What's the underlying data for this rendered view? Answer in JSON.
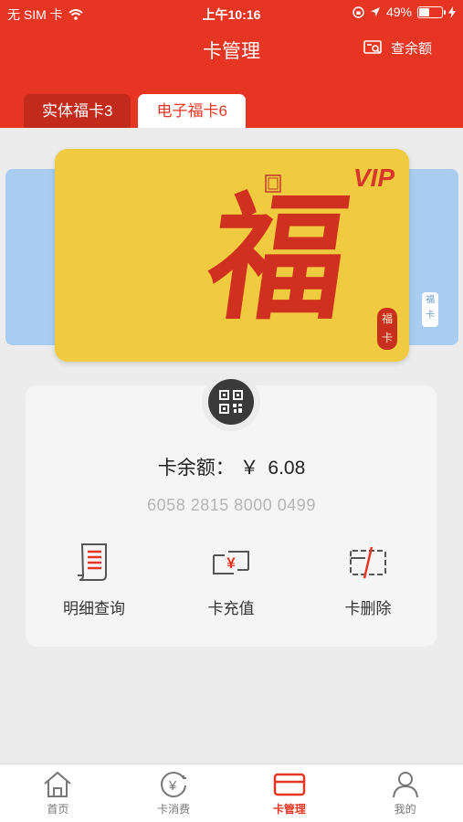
{
  "status_bar": {
    "carrier": "无 SIM 卡",
    "time": "上午10:16",
    "battery": "49%",
    "battery_level": 0.49
  },
  "header": {
    "title": "卡管理",
    "balance_button": "查余额"
  },
  "tabs": [
    {
      "label": "实体福卡3",
      "active": false
    },
    {
      "label": "电子福卡6",
      "active": true
    }
  ],
  "card": {
    "badge": "VIP",
    "main_char": "福",
    "seal": "福卡"
  },
  "details": {
    "balance_label": "卡余额：",
    "currency": "￥",
    "balance": "6.08",
    "card_number": "6058 2815 8000 0499"
  },
  "actions": [
    {
      "label": "明细查询",
      "icon": "receipt-icon"
    },
    {
      "label": "卡充值",
      "icon": "card-recharge-icon"
    },
    {
      "label": "卡删除",
      "icon": "card-delete-icon"
    }
  ],
  "bottom_nav": [
    {
      "label": "首页",
      "icon": "home-icon",
      "active": false
    },
    {
      "label": "卡消费",
      "icon": "yen-clock-icon",
      "active": false
    },
    {
      "label": "卡管理",
      "icon": "card-icon",
      "active": true
    },
    {
      "label": "我的",
      "icon": "person-icon",
      "active": false
    }
  ],
  "colors": {
    "brand_red": "#e63523",
    "card_gold": "#f1cb3f",
    "card_blue": "#a9cdf0"
  }
}
